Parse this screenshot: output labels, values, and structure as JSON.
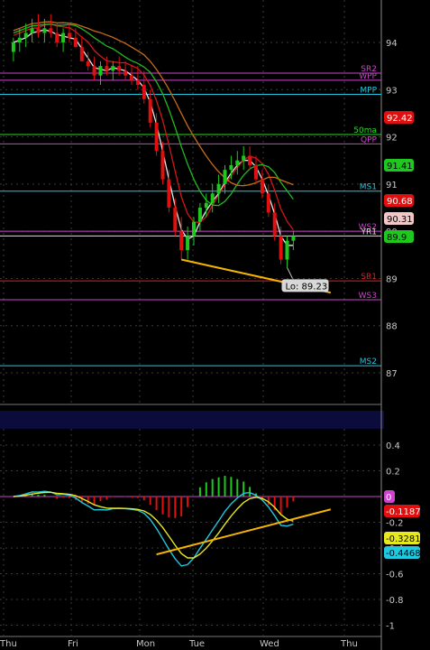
{
  "colors": {
    "background": "#000000",
    "grid": "#3a3a3a",
    "axis_text": "#c8c8c8",
    "candle_up": "#1ec81e",
    "candle_down": "#e01010",
    "ma_green": "#22b822",
    "ma_red": "#d01818",
    "ma_pink": "#e07070",
    "ma_white": "#e6e6e6",
    "ma_orange": "#c86a1a",
    "trendline": "#f5b400",
    "macd_line": "#20c8e0",
    "signal_line": "#e8e820",
    "histogram_pos": "#1ec81e",
    "histogram_neg": "#e01010",
    "separator_band": "#0b0b3c"
  },
  "chart_data": [
    {
      "type": "line",
      "panel": "price",
      "x_labels": [
        "Thu",
        "Fri",
        "Mon",
        "Tue",
        "Wed",
        "Thu"
      ],
      "ylim": [
        86.6,
        95
      ],
      "y_ticks": [
        87,
        88,
        89,
        90,
        91,
        92,
        93,
        94
      ],
      "grid": true,
      "candles": [
        [
          1,
          93.8,
          94.1,
          93.6,
          94.0
        ],
        [
          2,
          94.0,
          94.3,
          93.8,
          94.1
        ],
        [
          3,
          94.1,
          94.4,
          93.9,
          94.2
        ],
        [
          4,
          94.2,
          94.5,
          94.0,
          94.3
        ],
        [
          5,
          94.3,
          94.6,
          94.1,
          94.2
        ],
        [
          6,
          94.2,
          94.5,
          94.0,
          94.3
        ],
        [
          7,
          94.3,
          94.6,
          94.1,
          94.2
        ],
        [
          8,
          94.2,
          94.4,
          93.9,
          94.0
        ],
        [
          9,
          94.0,
          94.3,
          93.8,
          94.2
        ],
        [
          10,
          94.2,
          94.4,
          94.0,
          94.1
        ],
        [
          11,
          94.1,
          94.3,
          93.9,
          93.9
        ],
        [
          12,
          93.9,
          94.1,
          93.6,
          93.6
        ],
        [
          13,
          93.6,
          93.8,
          93.4,
          93.5
        ],
        [
          14,
          93.5,
          93.7,
          93.2,
          93.3
        ],
        [
          15,
          93.3,
          93.6,
          93.1,
          93.5
        ],
        [
          16,
          93.5,
          93.7,
          93.3,
          93.4
        ],
        [
          17,
          93.4,
          93.6,
          93.2,
          93.5
        ],
        [
          18,
          93.5,
          93.7,
          93.3,
          93.4
        ],
        [
          19,
          93.4,
          93.6,
          93.2,
          93.3
        ],
        [
          20,
          93.3,
          93.5,
          93.1,
          93.2
        ],
        [
          21,
          93.2,
          93.5,
          93.0,
          93.1
        ],
        [
          22,
          93.1,
          93.4,
          92.7,
          92.8
        ],
        [
          23,
          92.8,
          93.0,
          92.2,
          92.3
        ],
        [
          24,
          92.3,
          92.5,
          91.6,
          91.7
        ],
        [
          25,
          91.7,
          91.9,
          91.0,
          91.1
        ],
        [
          26,
          91.1,
          91.3,
          90.4,
          90.5
        ],
        [
          27,
          90.5,
          90.7,
          89.9,
          90.0
        ],
        [
          28,
          90.0,
          90.3,
          89.4,
          89.6
        ],
        [
          29,
          89.6,
          90.1,
          89.4,
          89.9
        ],
        [
          30,
          89.9,
          90.3,
          89.7,
          90.2
        ],
        [
          31,
          90.2,
          90.6,
          90.0,
          90.5
        ],
        [
          32,
          90.5,
          90.8,
          90.3,
          90.6
        ],
        [
          33,
          90.6,
          91.0,
          90.4,
          90.8
        ],
        [
          34,
          90.8,
          91.2,
          90.6,
          91.0
        ],
        [
          35,
          91.0,
          91.4,
          90.8,
          91.3
        ],
        [
          36,
          91.3,
          91.6,
          91.1,
          91.4
        ],
        [
          37,
          91.4,
          91.7,
          91.2,
          91.5
        ],
        [
          38,
          91.5,
          91.8,
          91.3,
          91.6
        ],
        [
          39,
          91.6,
          91.8,
          91.3,
          91.4
        ],
        [
          40,
          91.4,
          91.6,
          91.0,
          91.1
        ],
        [
          41,
          91.1,
          91.3,
          90.7,
          90.8
        ],
        [
          42,
          90.8,
          91.0,
          90.3,
          90.4
        ],
        [
          43,
          90.4,
          90.6,
          89.8,
          89.9
        ],
        [
          44,
          89.9,
          90.1,
          89.3,
          89.4
        ],
        [
          45,
          89.4,
          89.9,
          89.23,
          89.8
        ],
        [
          46,
          89.8,
          90.0,
          89.6,
          89.9
        ]
      ],
      "levels": [
        {
          "label": "SR2",
          "value": 93.35,
          "color": "#cc44cc"
        },
        {
          "label": "WPP",
          "value": 93.2,
          "color": "#cc44cc"
        },
        {
          "label": "MPP",
          "value": 92.9,
          "color": "#22c8e0"
        },
        {
          "label": "50ma",
          "value": 92.05,
          "color": "#22dd22"
        },
        {
          "label": "QPP",
          "value": 91.85,
          "color": "#cc44cc"
        },
        {
          "label": "MS1",
          "value": 90.85,
          "color": "#22c8e0"
        },
        {
          "label": "WS2",
          "value": 90.0,
          "color": "#cc44cc"
        },
        {
          "label": "YR1",
          "value": 89.9,
          "color": "#dddddd"
        },
        {
          "label": "SR1",
          "value": 88.95,
          "color": "#e02020"
        },
        {
          "label": "WS3",
          "value": 88.55,
          "color": "#cc44cc"
        },
        {
          "label": "MS2",
          "value": 87.15,
          "color": "#22c8e0"
        }
      ],
      "price_tags": [
        {
          "value": "92.42",
          "bg": "#e01010",
          "fg": "#ffffff"
        },
        {
          "value": "91.41",
          "bg": "#1ec81e",
          "fg": "#000000"
        },
        {
          "value": "90.68",
          "bg": "#e01010",
          "fg": "#ffffff"
        },
        {
          "value": "90.31",
          "bg": "#f0c8c8",
          "fg": "#000000"
        },
        {
          "value": "89.9",
          "bg": "#1ec81e",
          "fg": "#000000"
        }
      ],
      "annotation": {
        "text": "Lo: 89.23",
        "value": 89.23
      },
      "trendline": [
        [
          28,
          89.4
        ],
        [
          52,
          88.7
        ]
      ]
    },
    {
      "type": "line",
      "panel": "macd",
      "ylim": [
        -1.05,
        0.5
      ],
      "y_ticks": [
        "0.4",
        "0.2",
        "0",
        "-0.2",
        "-0.4",
        "-0.6",
        "-0.8",
        "-1"
      ],
      "value_tags": [
        {
          "value": "0",
          "bg": "#cc44cc",
          "fg": "#ffffff"
        },
        {
          "value": "-0.1187",
          "bg": "#e01010",
          "fg": "#ffffff"
        },
        {
          "value": "-0.3281",
          "bg": "#e8e820",
          "fg": "#000000"
        },
        {
          "value": "-0.4468",
          "bg": "#20c8e0",
          "fg": "#000000"
        }
      ],
      "trendline": [
        [
          24,
          -0.45
        ],
        [
          52,
          -0.1
        ]
      ]
    }
  ]
}
